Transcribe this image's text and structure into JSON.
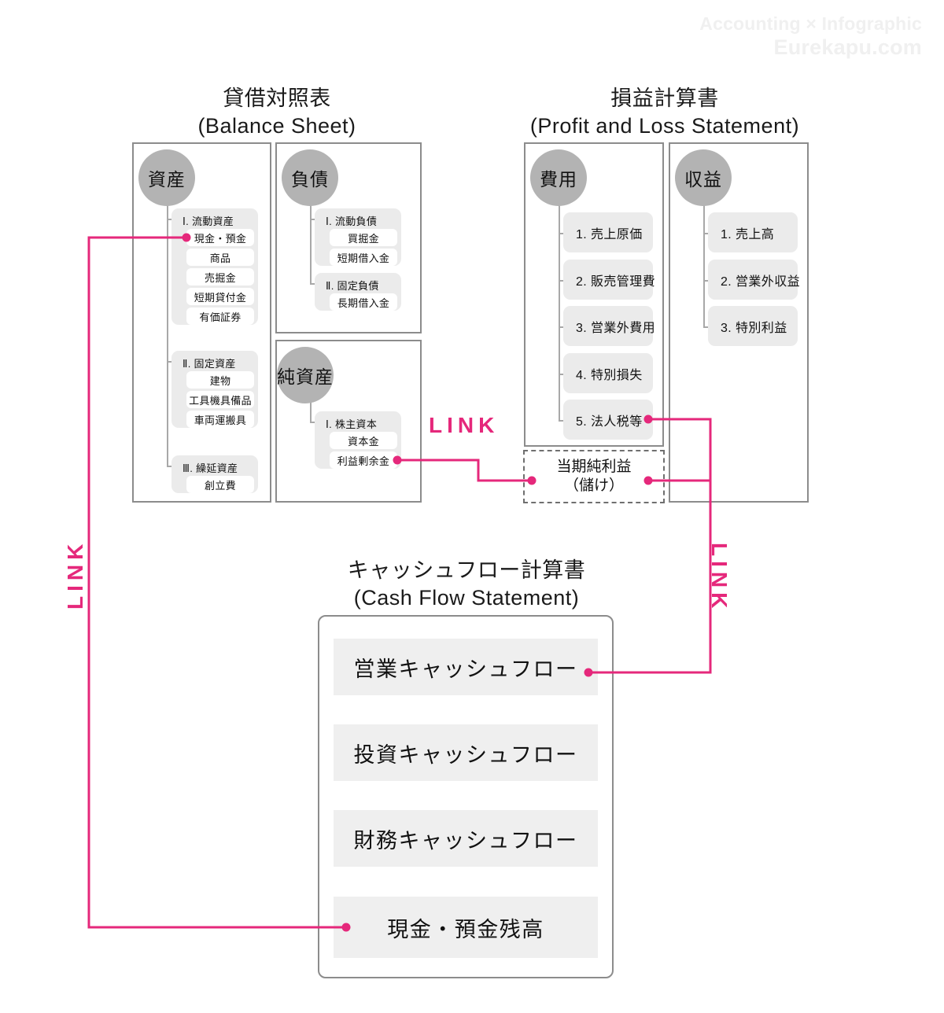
{
  "watermark": {
    "line1": "Accounting × Infographic",
    "line2": "Eurekapu.com"
  },
  "colors": {
    "link_pink": "#e5287b",
    "bubble_grey": "#b3b3b3",
    "panel_border": "#8c8c8c",
    "group_grey": "#ebebeb",
    "chip_white": "#ffffff",
    "cf_row_grey": "#efefef",
    "watermark_grey": "#f0f0f0"
  },
  "balance_sheet": {
    "title_ja": "貸借対照表",
    "title_en": "(Balance Sheet)",
    "assets": {
      "bubble": "資産",
      "groups": [
        {
          "label": "Ⅰ. 流動資産",
          "items": [
            "現金・預金",
            "商品",
            "売掘金",
            "短期貸付金",
            "有価証券"
          ]
        },
        {
          "label": "Ⅱ. 固定資産",
          "items": [
            "建物",
            "工具機具備品",
            "車両運搬具"
          ]
        },
        {
          "label": "Ⅲ. 繰延資産",
          "items": [
            "創立費"
          ]
        }
      ]
    },
    "liabilities": {
      "bubble": "負債",
      "groups": [
        {
          "label": "Ⅰ. 流動負債",
          "items": [
            "買掘金",
            "短期借入金"
          ]
        },
        {
          "label": "Ⅱ. 固定負債",
          "items": [
            "長期借入金"
          ]
        }
      ]
    },
    "net_assets": {
      "bubble": "純資産",
      "groups": [
        {
          "label": "Ⅰ. 株主資本",
          "items": [
            "資本金",
            "利益剰余金"
          ]
        }
      ]
    }
  },
  "profit_loss": {
    "title_ja": "損益計算書",
    "title_en": "(Profit and Loss Statement)",
    "expenses": {
      "bubble": "費用",
      "items": [
        "1. 売上原価",
        "2. 販売管理費",
        "3. 営業外費用",
        "4. 特別損失",
        "5. 法人税等"
      ]
    },
    "revenue": {
      "bubble": "収益",
      "items": [
        "1. 売上高",
        "2. 営業外収益",
        "3. 特別利益"
      ]
    },
    "net_income": {
      "line1": "当期純利益",
      "line2": "（儲け）"
    }
  },
  "cash_flow": {
    "title_ja": "キャッシュフロー計算書",
    "title_en": "(Cash Flow Statement)",
    "items": [
      "営業キャッシュフロー",
      "投資キャッシュフロー",
      "財務キャッシュフロー",
      "現金・預金残高"
    ]
  },
  "links": {
    "label": "LINK",
    "left_label": "LINK",
    "center_label": "LINK",
    "right_label": "LINK"
  }
}
